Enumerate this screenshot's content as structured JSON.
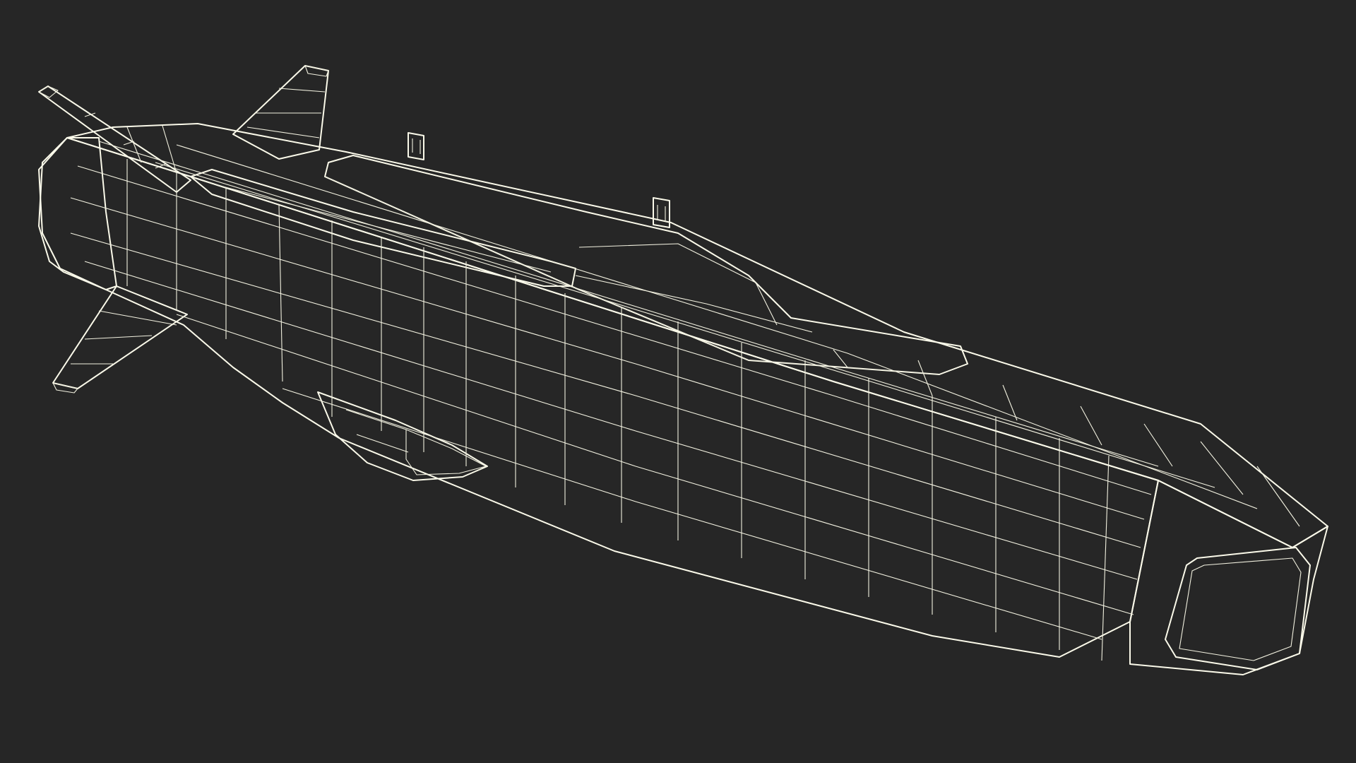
{
  "scene": {
    "background_color": "#262626",
    "surface_color": "#787a6e",
    "surface_shadow_color": "#5f6157",
    "surface_highlight_color": "#8a8c80",
    "wire_color": "#f2f1e0",
    "subject": "missile-wireframe-model"
  }
}
